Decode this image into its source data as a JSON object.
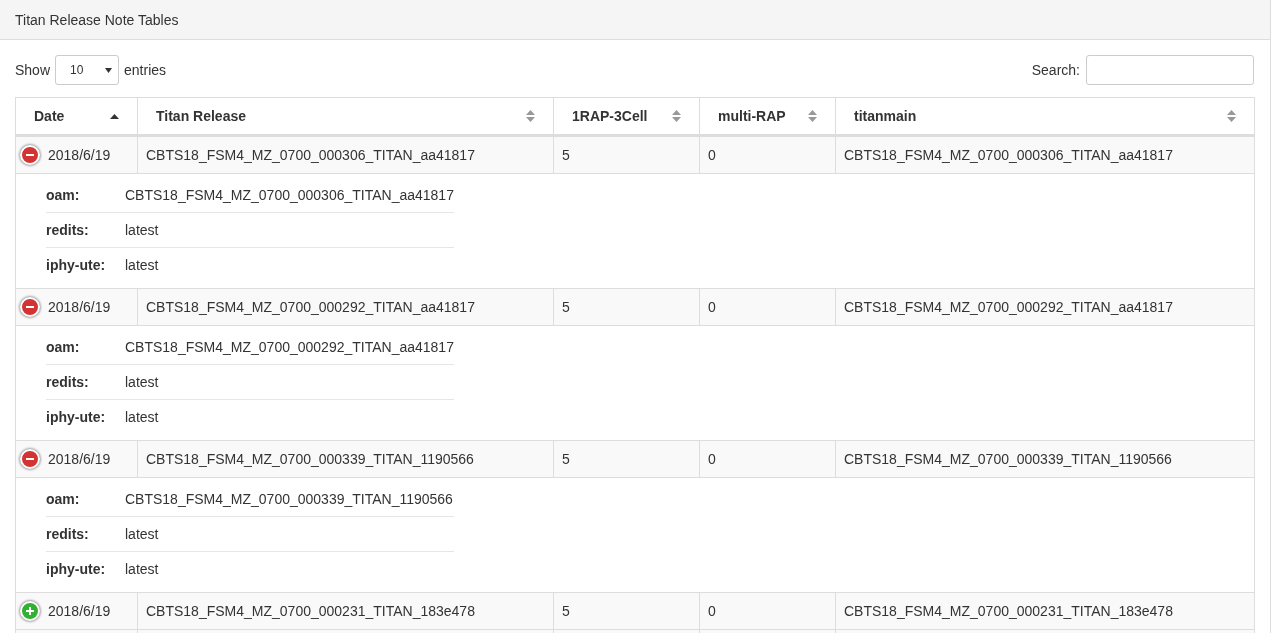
{
  "panel": {
    "title": "Titan Release Note Tables"
  },
  "length_control": {
    "before": "Show",
    "value": "10",
    "after": "entries"
  },
  "search": {
    "label": "Search:"
  },
  "columns": [
    {
      "label": "Date",
      "sorted": true
    },
    {
      "label": "Titan Release",
      "sorted": false
    },
    {
      "label": "1RAP-3Cell",
      "sorted": false
    },
    {
      "label": "multi-RAP",
      "sorted": false
    },
    {
      "label": "titanmain",
      "sorted": false
    }
  ],
  "rows": [
    {
      "expanded": true,
      "cells": [
        "2018/6/19",
        "CBTS18_FSM4_MZ_0700_000306_TITAN_aa41817",
        "5",
        "0",
        "CBTS18_FSM4_MZ_0700_000306_TITAN_aa41817"
      ],
      "details": [
        {
          "label": "oam:",
          "value": "CBTS18_FSM4_MZ_0700_000306_TITAN_aa41817"
        },
        {
          "label": "redits:",
          "value": "latest"
        },
        {
          "label": "iphy-ute:",
          "value": "latest"
        }
      ]
    },
    {
      "expanded": true,
      "cells": [
        "2018/6/19",
        "CBTS18_FSM4_MZ_0700_000292_TITAN_aa41817",
        "5",
        "0",
        "CBTS18_FSM4_MZ_0700_000292_TITAN_aa41817"
      ],
      "details": [
        {
          "label": "oam:",
          "value": "CBTS18_FSM4_MZ_0700_000292_TITAN_aa41817"
        },
        {
          "label": "redits:",
          "value": "latest"
        },
        {
          "label": "iphy-ute:",
          "value": "latest"
        }
      ]
    },
    {
      "expanded": true,
      "cells": [
        "2018/6/19",
        "CBTS18_FSM4_MZ_0700_000339_TITAN_1190566",
        "5",
        "0",
        "CBTS18_FSM4_MZ_0700_000339_TITAN_1190566"
      ],
      "details": [
        {
          "label": "oam:",
          "value": "CBTS18_FSM4_MZ_0700_000339_TITAN_1190566"
        },
        {
          "label": "redits:",
          "value": "latest"
        },
        {
          "label": "iphy-ute:",
          "value": "latest"
        }
      ]
    },
    {
      "expanded": false,
      "cells": [
        "2018/6/19",
        "CBTS18_FSM4_MZ_0700_000231_TITAN_183e478",
        "5",
        "0",
        "CBTS18_FSM4_MZ_0700_000231_TITAN_183e478"
      ]
    }
  ]
}
